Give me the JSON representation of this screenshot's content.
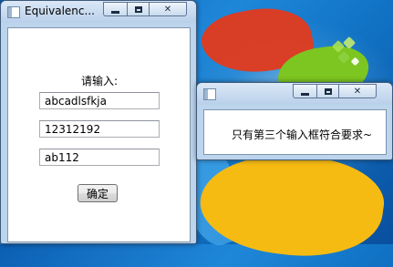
{
  "main_window": {
    "title": "Equivalenc...",
    "prompt_label": "请输入:",
    "inputs": [
      {
        "value": "abcadlsfkja"
      },
      {
        "value": "12312192"
      },
      {
        "value": "ab112"
      }
    ],
    "ok_label": "确定"
  },
  "dialog": {
    "title": "",
    "message": "只有第三个输入框符合要求~"
  },
  "icons": {
    "minimize": "minimize-icon",
    "maximize": "maximize-icon",
    "close": "close-icon",
    "app": "app-window-icon"
  },
  "colors": {
    "desktop_blue": "#1172c4",
    "titlebar": "#bcd4ec",
    "client_bg": "#ffffff"
  }
}
